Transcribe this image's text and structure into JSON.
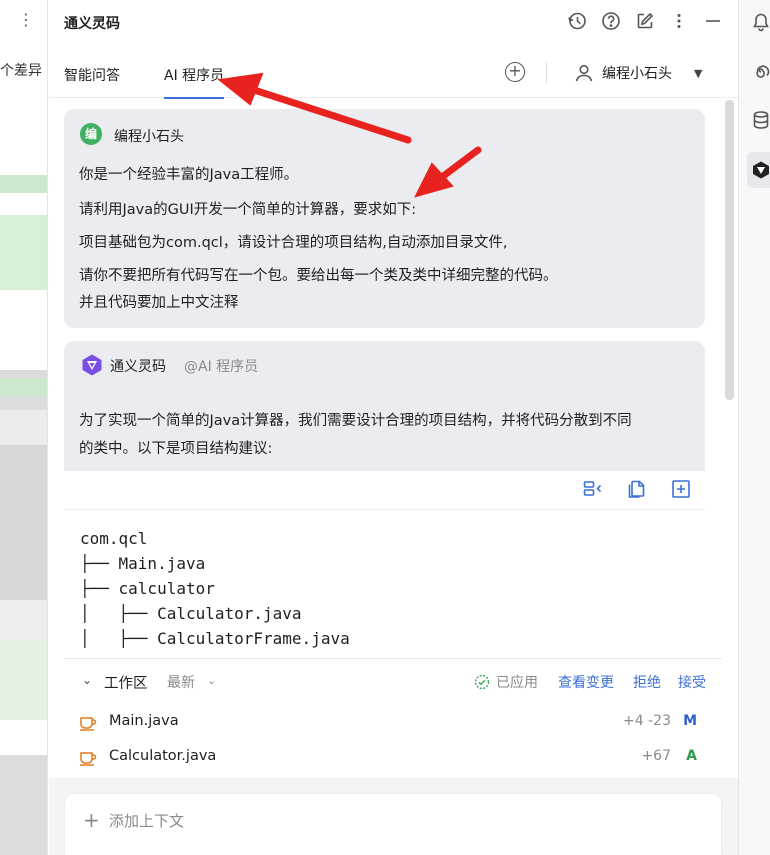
{
  "left_strip": {
    "kebab": "⋮",
    "diff_text": "个差异"
  },
  "header": {
    "title": "通义灵码",
    "icons": [
      "history-icon",
      "help-icon",
      "edit-icon",
      "more-icon",
      "minimize-icon"
    ]
  },
  "tabs": [
    {
      "label": "智能问答",
      "active": false
    },
    {
      "label": "AI 程序员",
      "active": true
    }
  ],
  "user_selector": {
    "name": "编程小石头"
  },
  "messages": {
    "user": {
      "avatar": "编",
      "name": "编程小石头",
      "lines": [
        "你是一个经验丰富的Java工程师。",
        "请利用Java的GUI开发一个简单的计算器，要求如下:",
        "项目基础包为com.qcl，请设计合理的项目结构,自动添加目录文件,",
        "请你不要把所有代码写在一个包。要给出每一个类及类中详细完整的代码。",
        "并且代码要加上中文注释"
      ]
    },
    "ai": {
      "name": "通义灵码",
      "mention": "@AI 程序员",
      "lines": [
        "为了实现一个简单的Java计算器，我们需要设计合理的项目结构，并将代码分散到不同",
        "的类中。以下是项目结构建议:"
      ],
      "code_lines": [
        "com.qcl",
        "├── Main.java",
        "├── calculator",
        "│   ├── Calculator.java",
        "│   ├── CalculatorFrame.java"
      ]
    }
  },
  "workspace": {
    "title": "工作区",
    "filter": "最新",
    "applied": "已应用",
    "view_changes": "查看变更",
    "reject": "拒绝",
    "accept": "接受",
    "files": [
      {
        "name": "Main.java",
        "delta": "+4 -23",
        "status": "M",
        "status_color": "#2f5fc9"
      },
      {
        "name": "Calculator.java",
        "delta": "+67",
        "status": "A",
        "status_color": "#2e9b48"
      }
    ]
  },
  "composer": {
    "add_context": "添加上下文"
  },
  "colors": {
    "accent": "#3b6fd8",
    "annotation_arrow": "#e8231f",
    "bubble_bg": "#ebecf0"
  }
}
